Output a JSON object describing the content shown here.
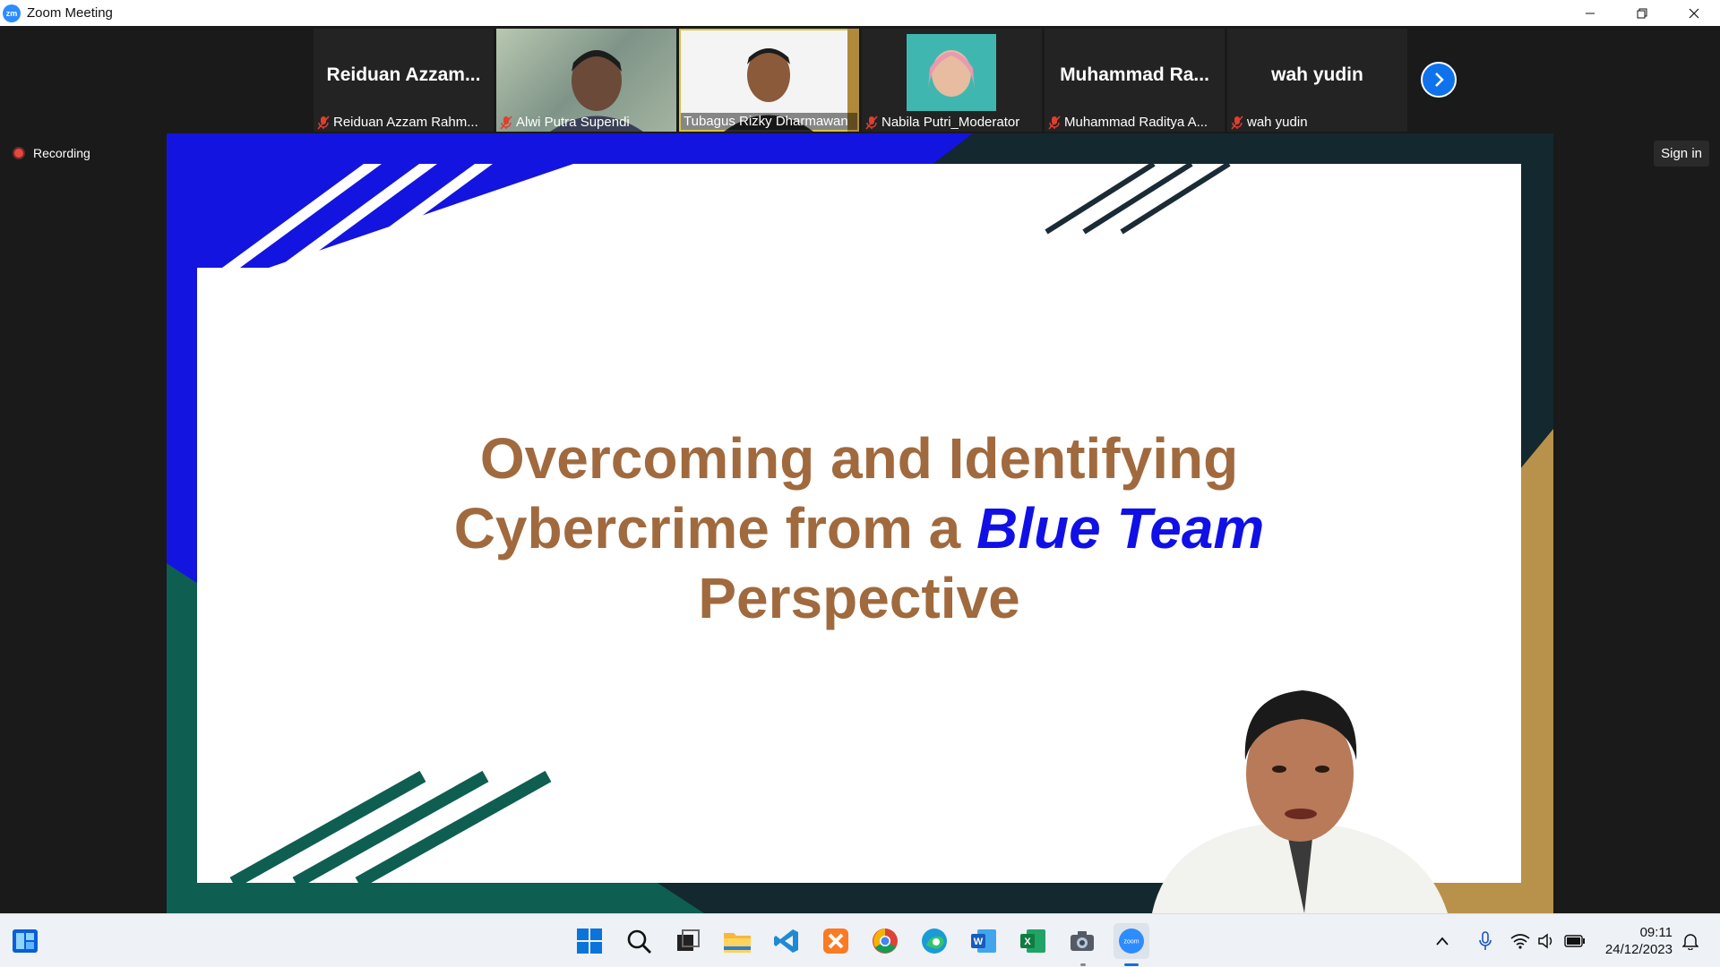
{
  "window": {
    "title": "Zoom Meeting",
    "app_icon_text": "zm"
  },
  "participants": [
    {
      "display_name": "Reiduan  Azzam...",
      "caption": "Reiduan Azzam Rahm...",
      "video": false,
      "muted": true
    },
    {
      "display_name": "",
      "caption": "Alwi Putra Supendi",
      "video": true,
      "muted": true
    },
    {
      "display_name": "",
      "caption": "Tubagus Rizky Dharmawan",
      "video": true,
      "muted": false,
      "active_speaker": true
    },
    {
      "display_name": "",
      "caption": "Nabila Putri_Moderator",
      "video": true,
      "muted": true
    },
    {
      "display_name": "Muhammad  Ra...",
      "caption": "Muhammad Raditya A...",
      "video": false,
      "muted": true
    },
    {
      "display_name": "wah yudin",
      "caption": "wah yudin",
      "video": false,
      "muted": true
    }
  ],
  "recording": {
    "label": "Recording"
  },
  "signin": {
    "label": "Sign in"
  },
  "slide": {
    "title_line1": "Overcoming and Identifying",
    "title_line2_before": "Cybercrime from a ",
    "title_line2_accent": "Blue Team",
    "title_line3": "Perspective",
    "colors": {
      "title": "#a06a3e",
      "accent": "#1010e6",
      "blue_stripe": "#1414e0",
      "green": "#0f5e52",
      "gold": "#b8924a",
      "navy": "#13282f"
    }
  },
  "taskbar": {
    "apps": [
      "start-icon",
      "search-icon",
      "task-view-icon",
      "file-explorer-icon",
      "vscode-icon",
      "xampp-icon",
      "chrome-icon",
      "edge-icon",
      "word-icon",
      "excel-icon",
      "camera-icon",
      "zoom-icon"
    ],
    "time": "09:11",
    "date": "24/12/2023",
    "zoom_label": "zoom"
  }
}
